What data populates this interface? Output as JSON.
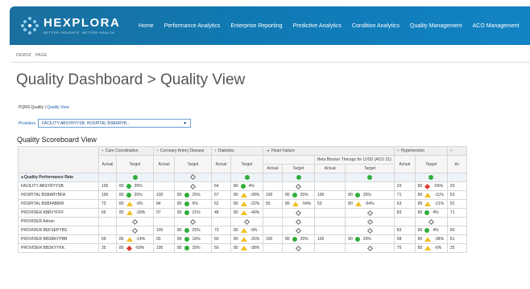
{
  "header": {
    "logo_name": "HEXPLORA",
    "logo_tagline": "BETTER INSIGHTS. BETTER HEALTH",
    "nav": [
      "Home",
      "Performance Analytics",
      "Enterprise Reporting",
      "Predictive Analytics",
      "Condition Analytics",
      "Quality Management",
      "ACO Management"
    ]
  },
  "breadcrumb": [
    "DEMOZ",
    "PAGE"
  ],
  "page_title": "Quality Dashboard > Quality View",
  "links": {
    "first": "PQRS Quality",
    "separator": "|",
    "second": "Quality View"
  },
  "provider": {
    "label": "Providers",
    "value": "FACILITY ABSYRYYSB, HOSPITAL BSBARYB...",
    "caret": "▼"
  },
  "section_title": "Quality Scoreboard View",
  "table": {
    "groups": [
      {
        "label": "Care Coordination",
        "arrow": "+"
      },
      {
        "label": "Coronary Artery Disease",
        "arrow": "+"
      },
      {
        "label": "Diabetes",
        "arrow": "+"
      },
      {
        "label": "Heart Failure",
        "arrow": "◄"
      },
      {
        "label": "Hypertension",
        "arrow": "+"
      },
      {
        "label": "",
        "arrow": "+"
      }
    ],
    "hf_subgroup": "Beta Blocker Therapy for LVSD (ACO 31)",
    "col_actual": "Actual",
    "col_target": "Target",
    "col_ac": "Ac",
    "perf_label": "Quality Performance Rate",
    "rows": [
      {
        "name": "FACILITY ABSYRYYSB",
        "cc": [
          "100",
          "80",
          "dot",
          "25%"
        ],
        "cad": [
          "",
          "",
          "odia",
          ""
        ],
        "dm": [
          "64",
          "80",
          "dot",
          "4%"
        ],
        "hf": [
          "",
          "",
          "odia",
          ""
        ],
        "hf2": [
          "",
          "",
          "",
          ""
        ],
        "ht": [
          "33",
          "80",
          "dia",
          "-59%"
        ],
        "x": "20"
      },
      {
        "name": "HOSPITAL BSBARYBFA",
        "cc": [
          "100",
          "80",
          "dot",
          "25%"
        ],
        "cad": [
          "100",
          "80",
          "dot",
          "25%"
        ],
        "dm": [
          "57",
          "80",
          "tri",
          "-28%"
        ],
        "hf": [
          "100",
          "80",
          "dot",
          "25%"
        ],
        "hf2": [
          "100",
          "80",
          "dot",
          "25%"
        ],
        "ht": [
          "71",
          "80",
          "tri",
          "-11%"
        ],
        "x": "53"
      },
      {
        "name": "HOSPITAL BSBFABBRI",
        "cc": [
          "73",
          "80",
          "tri",
          "-9%"
        ],
        "cad": [
          "84",
          "80",
          "dot",
          "5%"
        ],
        "dm": [
          "62",
          "80",
          "tri",
          "-22%"
        ],
        "hf": [
          "55",
          "80",
          "tri",
          "-54%"
        ],
        "hf2": [
          "53",
          "80",
          "tri",
          "-54%"
        ],
        "ht": [
          "63",
          "80",
          "tri",
          "-21%"
        ],
        "x": "52"
      },
      {
        "name": "PROVIDER ABRVYFFF",
        "cc": [
          "66",
          "80",
          "tri",
          "-18%"
        ],
        "cad": [
          "97",
          "80",
          "dot",
          "21%"
        ],
        "dm": [
          "48",
          "80",
          "tri",
          "-40%"
        ],
        "hf": [
          "",
          "",
          "odia",
          ""
        ],
        "hf2": [
          "",
          "",
          "odia",
          ""
        ],
        "ht": [
          "83",
          "80",
          "dot",
          "4%"
        ],
        "x": "71"
      },
      {
        "name": "PROVIDER Adrian",
        "cc": [
          "",
          "",
          "odia",
          ""
        ],
        "cad": [
          "",
          "",
          "odia",
          ""
        ],
        "dm": [
          "",
          "",
          "odia",
          ""
        ],
        "hf": [
          "",
          "",
          "odia",
          ""
        ],
        "hf2": [
          "",
          "",
          "odia",
          ""
        ],
        "ht": [
          "",
          "",
          "odia",
          ""
        ],
        "x": ""
      },
      {
        "name": "PROVIDER BEFSEPYBS",
        "cc": [
          "",
          "",
          "odia",
          ""
        ],
        "cad": [
          "100",
          "80",
          "dot",
          "25%"
        ],
        "dm": [
          "73",
          "80",
          "tri",
          "-9%"
        ],
        "hf": [
          "",
          "",
          "odia",
          ""
        ],
        "hf2": [
          "",
          "",
          "odia",
          ""
        ],
        "ht": [
          "83",
          "80",
          "dot",
          "4%"
        ],
        "x": "60"
      },
      {
        "name": "PROVIDER BBSBKYPBB",
        "cc": [
          "69",
          "80",
          "tri",
          "-14%"
        ],
        "cad": [
          "93",
          "80",
          "dot",
          "16%"
        ],
        "dm": [
          "60",
          "80",
          "tri",
          "-25%"
        ],
        "hf": [
          "100",
          "80",
          "dot",
          "25%"
        ],
        "hf2": [
          "100",
          "80",
          "dot",
          "25%"
        ],
        "ht": [
          "58",
          "80",
          "tri",
          "-38%"
        ],
        "x": "51"
      },
      {
        "name": "PROVIDER BBSKYYKK",
        "cc": [
          "25",
          "80",
          "dia",
          "-69%"
        ],
        "cad": [
          "100",
          "80",
          "dot",
          "25%"
        ],
        "dm": [
          "50",
          "80",
          "tri",
          "-38%"
        ],
        "hf": [
          "",
          "",
          "odia",
          ""
        ],
        "hf2": [
          "",
          "",
          "odia",
          ""
        ],
        "ht": [
          "75",
          "80",
          "tri",
          "-6%"
        ],
        "x": "25"
      }
    ]
  },
  "colors": {
    "header_blue": "#0f79b3",
    "good": "#2fae3a",
    "warn": "#f0c020",
    "bad": "#e03a2f",
    "link": "#1a5fa6"
  }
}
